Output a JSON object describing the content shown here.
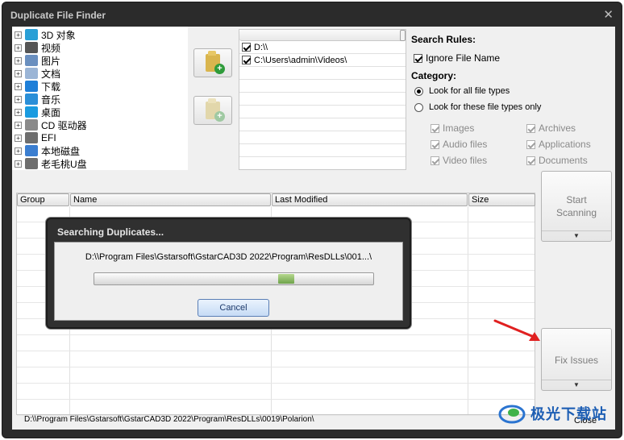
{
  "window": {
    "title": "Duplicate File Finder",
    "close_glyph": "✕"
  },
  "tree": {
    "items": [
      {
        "label": "3D 对象",
        "icon": "3d-objects-icon",
        "color": "#2a9fd6"
      },
      {
        "label": "视频",
        "icon": "video-icon",
        "color": "#555555"
      },
      {
        "label": "图片",
        "icon": "pictures-icon",
        "color": "#6a8fbf"
      },
      {
        "label": "文档",
        "icon": "documents-icon",
        "color": "#9bb5d6"
      },
      {
        "label": "下载",
        "icon": "downloads-icon",
        "color": "#1e7fd8"
      },
      {
        "label": "音乐",
        "icon": "music-icon",
        "color": "#2a8fd8"
      },
      {
        "label": "桌面",
        "icon": "desktop-icon",
        "color": "#1a9be0"
      },
      {
        "label": "CD 驱动器",
        "icon": "cd-drive-icon",
        "color": "#8a8a8a"
      },
      {
        "label": "EFI",
        "icon": "drive-icon",
        "color": "#6e6e6e"
      },
      {
        "label": "本地磁盘",
        "icon": "windows-drive-icon",
        "color": "#3b7ed0"
      },
      {
        "label": "老毛桃U盘",
        "icon": "usb-drive-icon",
        "color": "#6e6e6e"
      }
    ]
  },
  "paths": {
    "items": [
      {
        "label": "D:\\\\",
        "checked": true
      },
      {
        "label": "C:\\Users\\admin\\Videos\\",
        "checked": true
      }
    ]
  },
  "rules": {
    "heading": "Search Rules:",
    "ignore_file_name": "Ignore File Name",
    "category_heading": "Category:",
    "all_types": "Look for all file types",
    "these_types": "Look for these file types only",
    "types": {
      "images": "Images",
      "audio": "Audio files",
      "video": "Video files",
      "archives": "Archives",
      "applications": "Applications",
      "documents": "Documents"
    }
  },
  "buttons": {
    "start_line1": "Start",
    "start_line2": "Scanning",
    "fix_issues": "Fix Issues",
    "drop_glyph": "▼",
    "close": "Close"
  },
  "table": {
    "columns": [
      "Group",
      "Name",
      "Last Modified",
      "Size"
    ]
  },
  "status": "D:\\\\Program Files\\Gstarsoft\\GstarCAD3D 2022\\Program\\ResDLLs\\0019\\Polarion\\",
  "modal": {
    "title": "Searching Duplicates...",
    "path": "D:\\\\Program Files\\Gstarsoft\\GstarCAD3D 2022\\Program\\ResDLLs\\001...\\",
    "progress_indicator_position": 0.7,
    "cancel": "Cancel"
  },
  "watermark": {
    "text": "极光下载站"
  },
  "colors": {
    "arrow": "#e02020",
    "accent": "#1e5fb4"
  }
}
